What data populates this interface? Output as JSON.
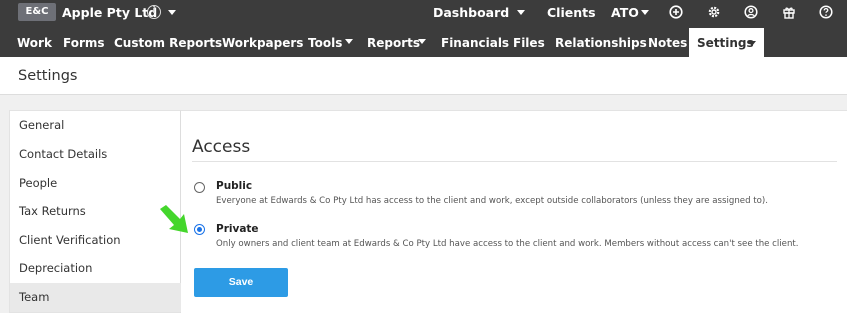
{
  "topbar": {
    "badge": "E&C",
    "client_name": "Apple Pty Ltd",
    "info_symbol": "i",
    "links": {
      "dashboard": "Dashboard",
      "clients": "Clients",
      "ato": "ATO"
    },
    "icons": [
      "plus-circle-icon",
      "gear-icon",
      "user-circle-icon",
      "gift-icon",
      "help-icon"
    ]
  },
  "nav": {
    "items": [
      "Work",
      "Forms",
      "Custom Reports",
      "Workpapers",
      "Tools",
      "Reports",
      "Financials",
      "Files",
      "Relationships",
      "Notes"
    ],
    "active": "Settings"
  },
  "page_title": "Settings",
  "sidebar": {
    "items": [
      "General",
      "Contact Details",
      "People",
      "Tax Returns",
      "Client Verification",
      "Depreciation",
      "Team"
    ],
    "active_index": 6
  },
  "access": {
    "title": "Access",
    "options": [
      {
        "label": "Public",
        "description": "Everyone at Edwards & Co Pty Ltd has access to the client and work, except outside collaborators (unless they are assigned to).",
        "selected": false
      },
      {
        "label": "Private",
        "description": "Only owners and client team at Edwards & Co Pty Ltd have access to the client and work. Members without access can't see the client.",
        "selected": true
      }
    ],
    "save_label": "Save"
  },
  "colors": {
    "topbar": "#3c3c3c",
    "accent": "#2d9be5",
    "arrow": "#44d62c"
  }
}
